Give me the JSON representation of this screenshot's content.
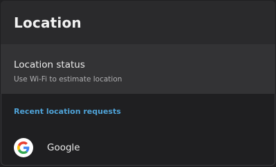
{
  "header": {
    "title": "Location"
  },
  "location_status": {
    "title": "Location status",
    "subtitle": "Use Wi-Fi to estimate location"
  },
  "recent_requests": {
    "section_title": "Recent location requests",
    "apps": [
      {
        "name": "Google",
        "icon": "google-g-icon"
      }
    ]
  },
  "colors": {
    "background": "#1f1f21",
    "header": "#2a2a2c",
    "selected_row": "#333335",
    "accent": "#4fa3d8"
  }
}
